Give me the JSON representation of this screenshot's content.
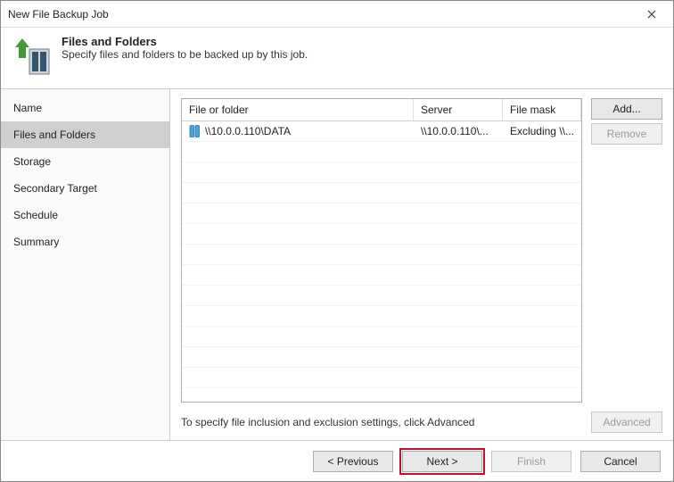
{
  "window": {
    "title": "New File Backup Job"
  },
  "header": {
    "title": "Files and Folders",
    "subtitle": "Specify files and folders to be backed up by this job."
  },
  "sidebar": {
    "items": [
      {
        "label": "Name"
      },
      {
        "label": "Files and Folders"
      },
      {
        "label": "Storage"
      },
      {
        "label": "Secondary Target"
      },
      {
        "label": "Schedule"
      },
      {
        "label": "Summary"
      }
    ],
    "selected_index": 1
  },
  "grid": {
    "columns": {
      "c1": "File or folder",
      "c2": "Server",
      "c3": "File mask"
    },
    "rows": [
      {
        "path": "\\\\10.0.0.110\\DATA",
        "server": "\\\\10.0.0.110\\...",
        "mask": "Excluding \\\\..."
      }
    ]
  },
  "buttons": {
    "add": "Add...",
    "remove": "Remove",
    "advanced": "Advanced",
    "previous": "< Previous",
    "next": "Next >",
    "finish": "Finish",
    "cancel": "Cancel"
  },
  "hint": "To specify file inclusion and exclusion settings, click Advanced"
}
